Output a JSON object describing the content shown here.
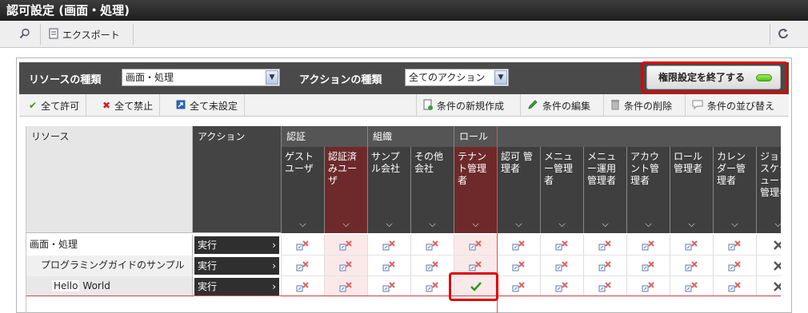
{
  "window": {
    "title": "認可設定 (画面・処理)"
  },
  "toolbar": {
    "export_label": "エクスポート"
  },
  "filter": {
    "resource_type_label": "リソースの種類",
    "resource_type_value": "画面・処理",
    "action_type_label": "アクションの種類",
    "action_type_value": "全てのアクション",
    "end_button_label": "権限設定を終了する"
  },
  "actions": {
    "allow_all": "全て許可",
    "deny_all": "全て禁止",
    "unset_all": "全て未設定",
    "new_condition": "条件の新規作成",
    "edit_condition": "条件の編集",
    "delete_condition": "条件の削除",
    "sort_condition": "条件の並び替え"
  },
  "grid": {
    "resource_header": "リソース",
    "action_header": "アクション",
    "groups": [
      "認証",
      "組織",
      "ロール"
    ],
    "columns": [
      "ゲスト ユーザ",
      "認証済 みユー ザ",
      "サンプ ル会社",
      "その他 会社",
      "テナン ト管理 者",
      "認可 管 理者",
      "メニュ ー管理 者",
      "メニュ ー運用 管理者",
      "アカウ ント管 理者",
      "ロール 管理者",
      "カレン ダー管 理者",
      "ジョブ スケジ ューラ 管理者"
    ],
    "rows": [
      {
        "resource": "画面・処理",
        "action": "実行"
      },
      {
        "resource": "プログラミングガイドのサンプル",
        "action": "実行"
      },
      {
        "resource_hello": "Hello",
        "resource_world": "World",
        "action": "実行"
      }
    ]
  }
}
